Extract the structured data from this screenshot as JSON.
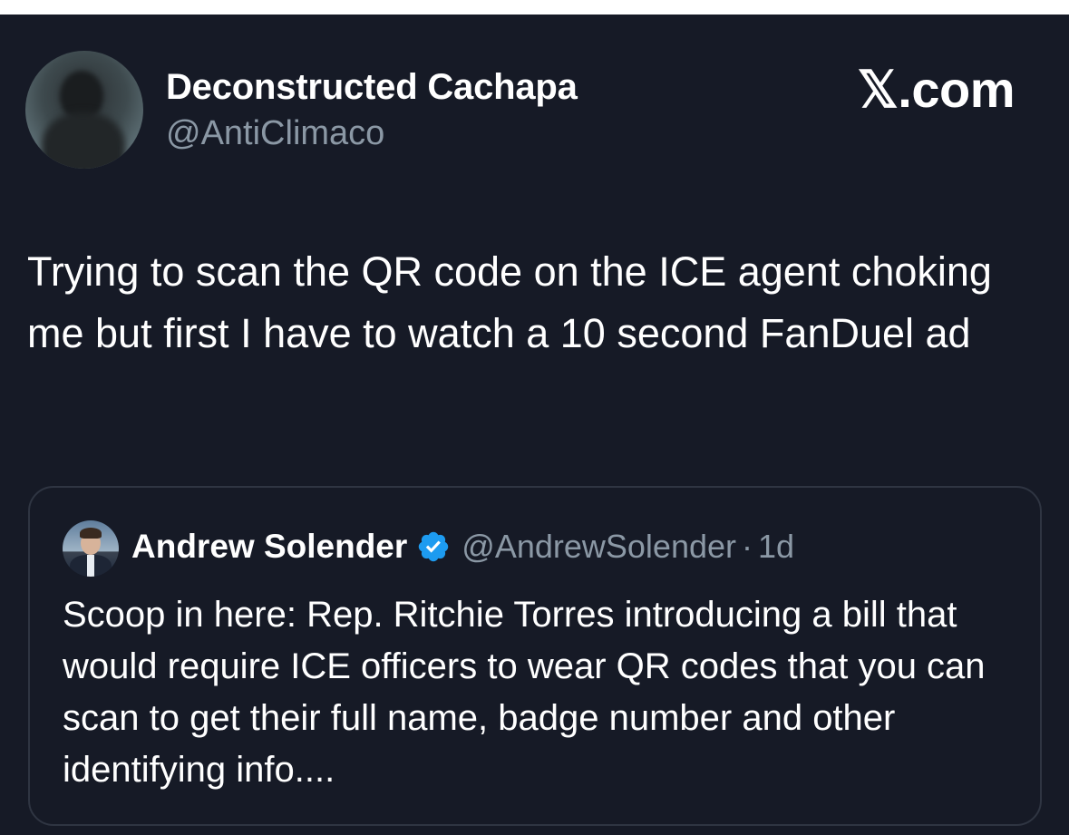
{
  "post": {
    "author": {
      "display_name": "Deconstructed Cachapa",
      "handle": "@AntiClimaco"
    },
    "brand": "𝕏.com",
    "text": "Trying to scan the QR code on the ICE agent choking me but first I have to watch a 10 second FanDuel ad"
  },
  "quoted_post": {
    "author": {
      "display_name": "Andrew Solender",
      "handle": "@AndrewSolender",
      "verified": true
    },
    "separator": "·",
    "time": "1d",
    "text": "Scoop in here: Rep. Ritchie Torres introducing a bill that would require ICE officers to wear QR codes that you can scan to get their full name, badge number and other identifying info...."
  },
  "icons": {
    "avatar": "profile-photo",
    "quoted_avatar": "profile-photo",
    "verified": "verified-badge-icon"
  },
  "colors": {
    "background": "#161a26",
    "text_primary": "#ffffff",
    "text_secondary": "#8b98a5",
    "verified_blue": "#1d9bf0",
    "card_border": "#2f3542"
  }
}
